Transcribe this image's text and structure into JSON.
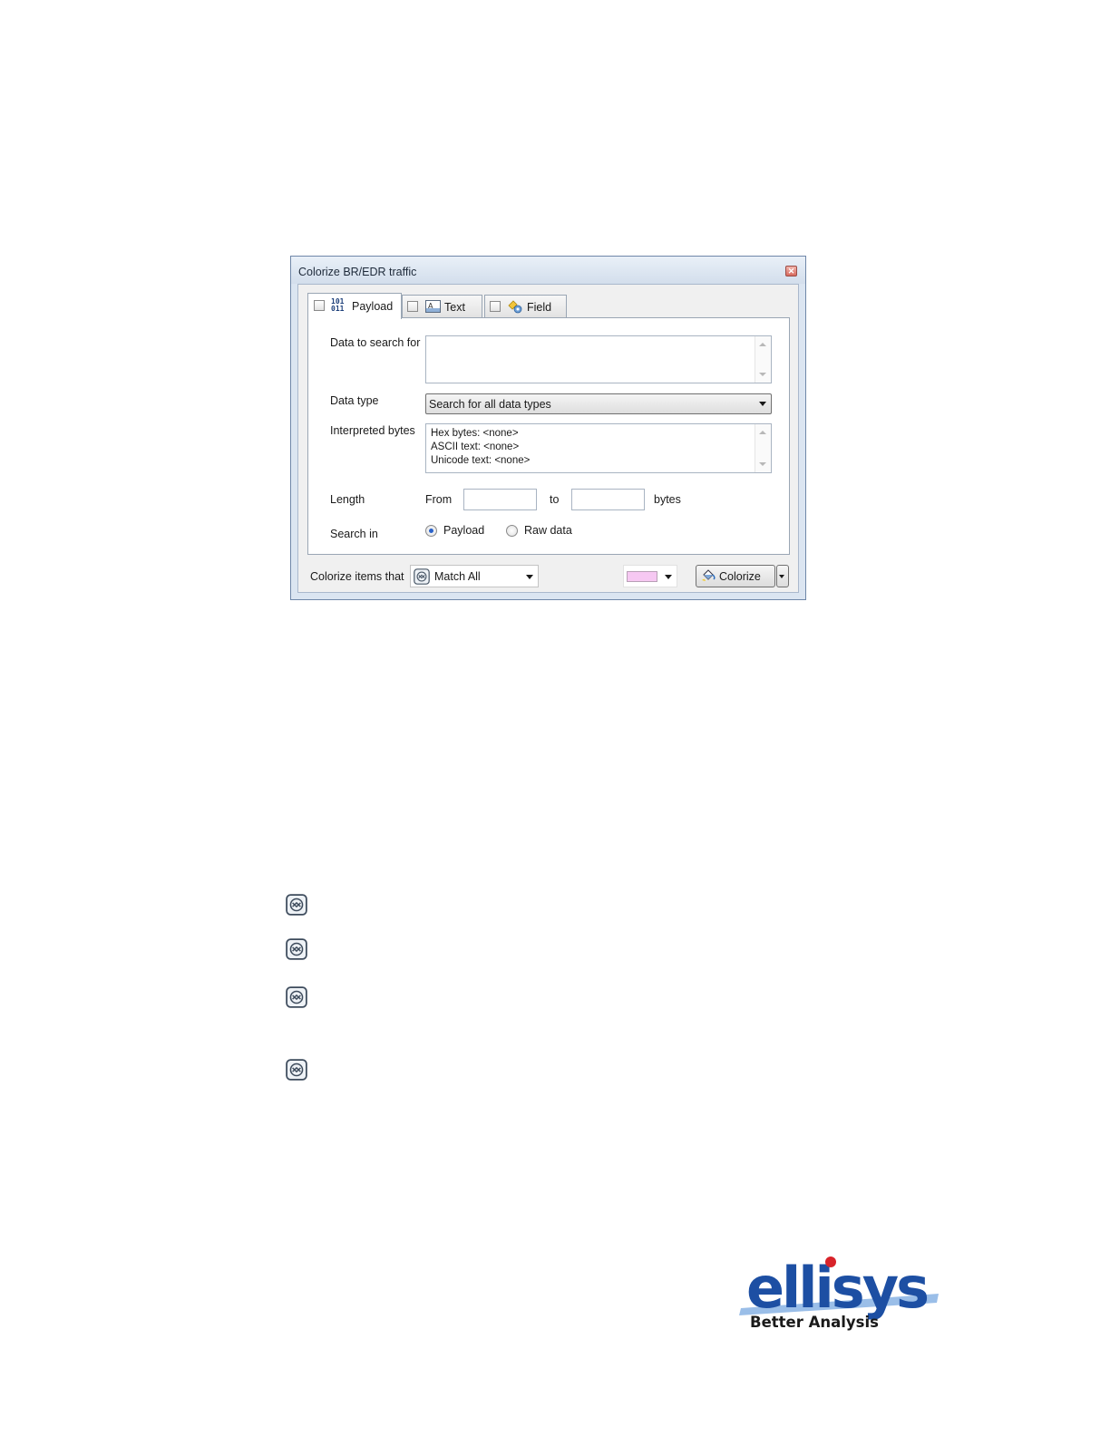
{
  "dialog": {
    "title": "Colorize BR/EDR traffic",
    "close_glyph": "✕",
    "tabs": [
      {
        "label": "Payload",
        "icon": "binary-icon",
        "icon_text_top": "101",
        "icon_text_bottom": "011",
        "active": true
      },
      {
        "label": "Text",
        "icon": "text-icon",
        "active": false
      },
      {
        "label": "Field",
        "icon": "field-icon",
        "active": false
      }
    ],
    "form": {
      "data_to_search_label": "Data to search for",
      "data_to_search_value": "",
      "data_type_label": "Data type",
      "data_type_value": "Search for all data types",
      "interpreted_label": "Interpreted bytes",
      "interpreted_lines": [
        "Hex bytes: <none>",
        "ASCII text: <none>",
        "Unicode text: <none>"
      ],
      "length_label": "Length",
      "from_label": "From",
      "from_value": "",
      "to_label": "to",
      "to_value": "",
      "bytes_label": "bytes",
      "search_in_label": "Search in",
      "search_in_options": [
        "Payload",
        "Raw data"
      ],
      "search_in_selected": "Payload"
    },
    "bottom": {
      "colorize_items_label": "Colorize items that",
      "match_value": "Match All",
      "color_swatch": "#f6c8f2",
      "colorize_button": "Colorize",
      "colorize_accel": "z"
    }
  },
  "page_icons": [
    "match-all-icon",
    "match-all-icon",
    "match-all-icon",
    "match-all-icon"
  ],
  "logo": {
    "brand": "ellisys",
    "tagline": "Better Analysis",
    "brand_color": "#1d4fa3",
    "dot_color": "#d8232a"
  }
}
